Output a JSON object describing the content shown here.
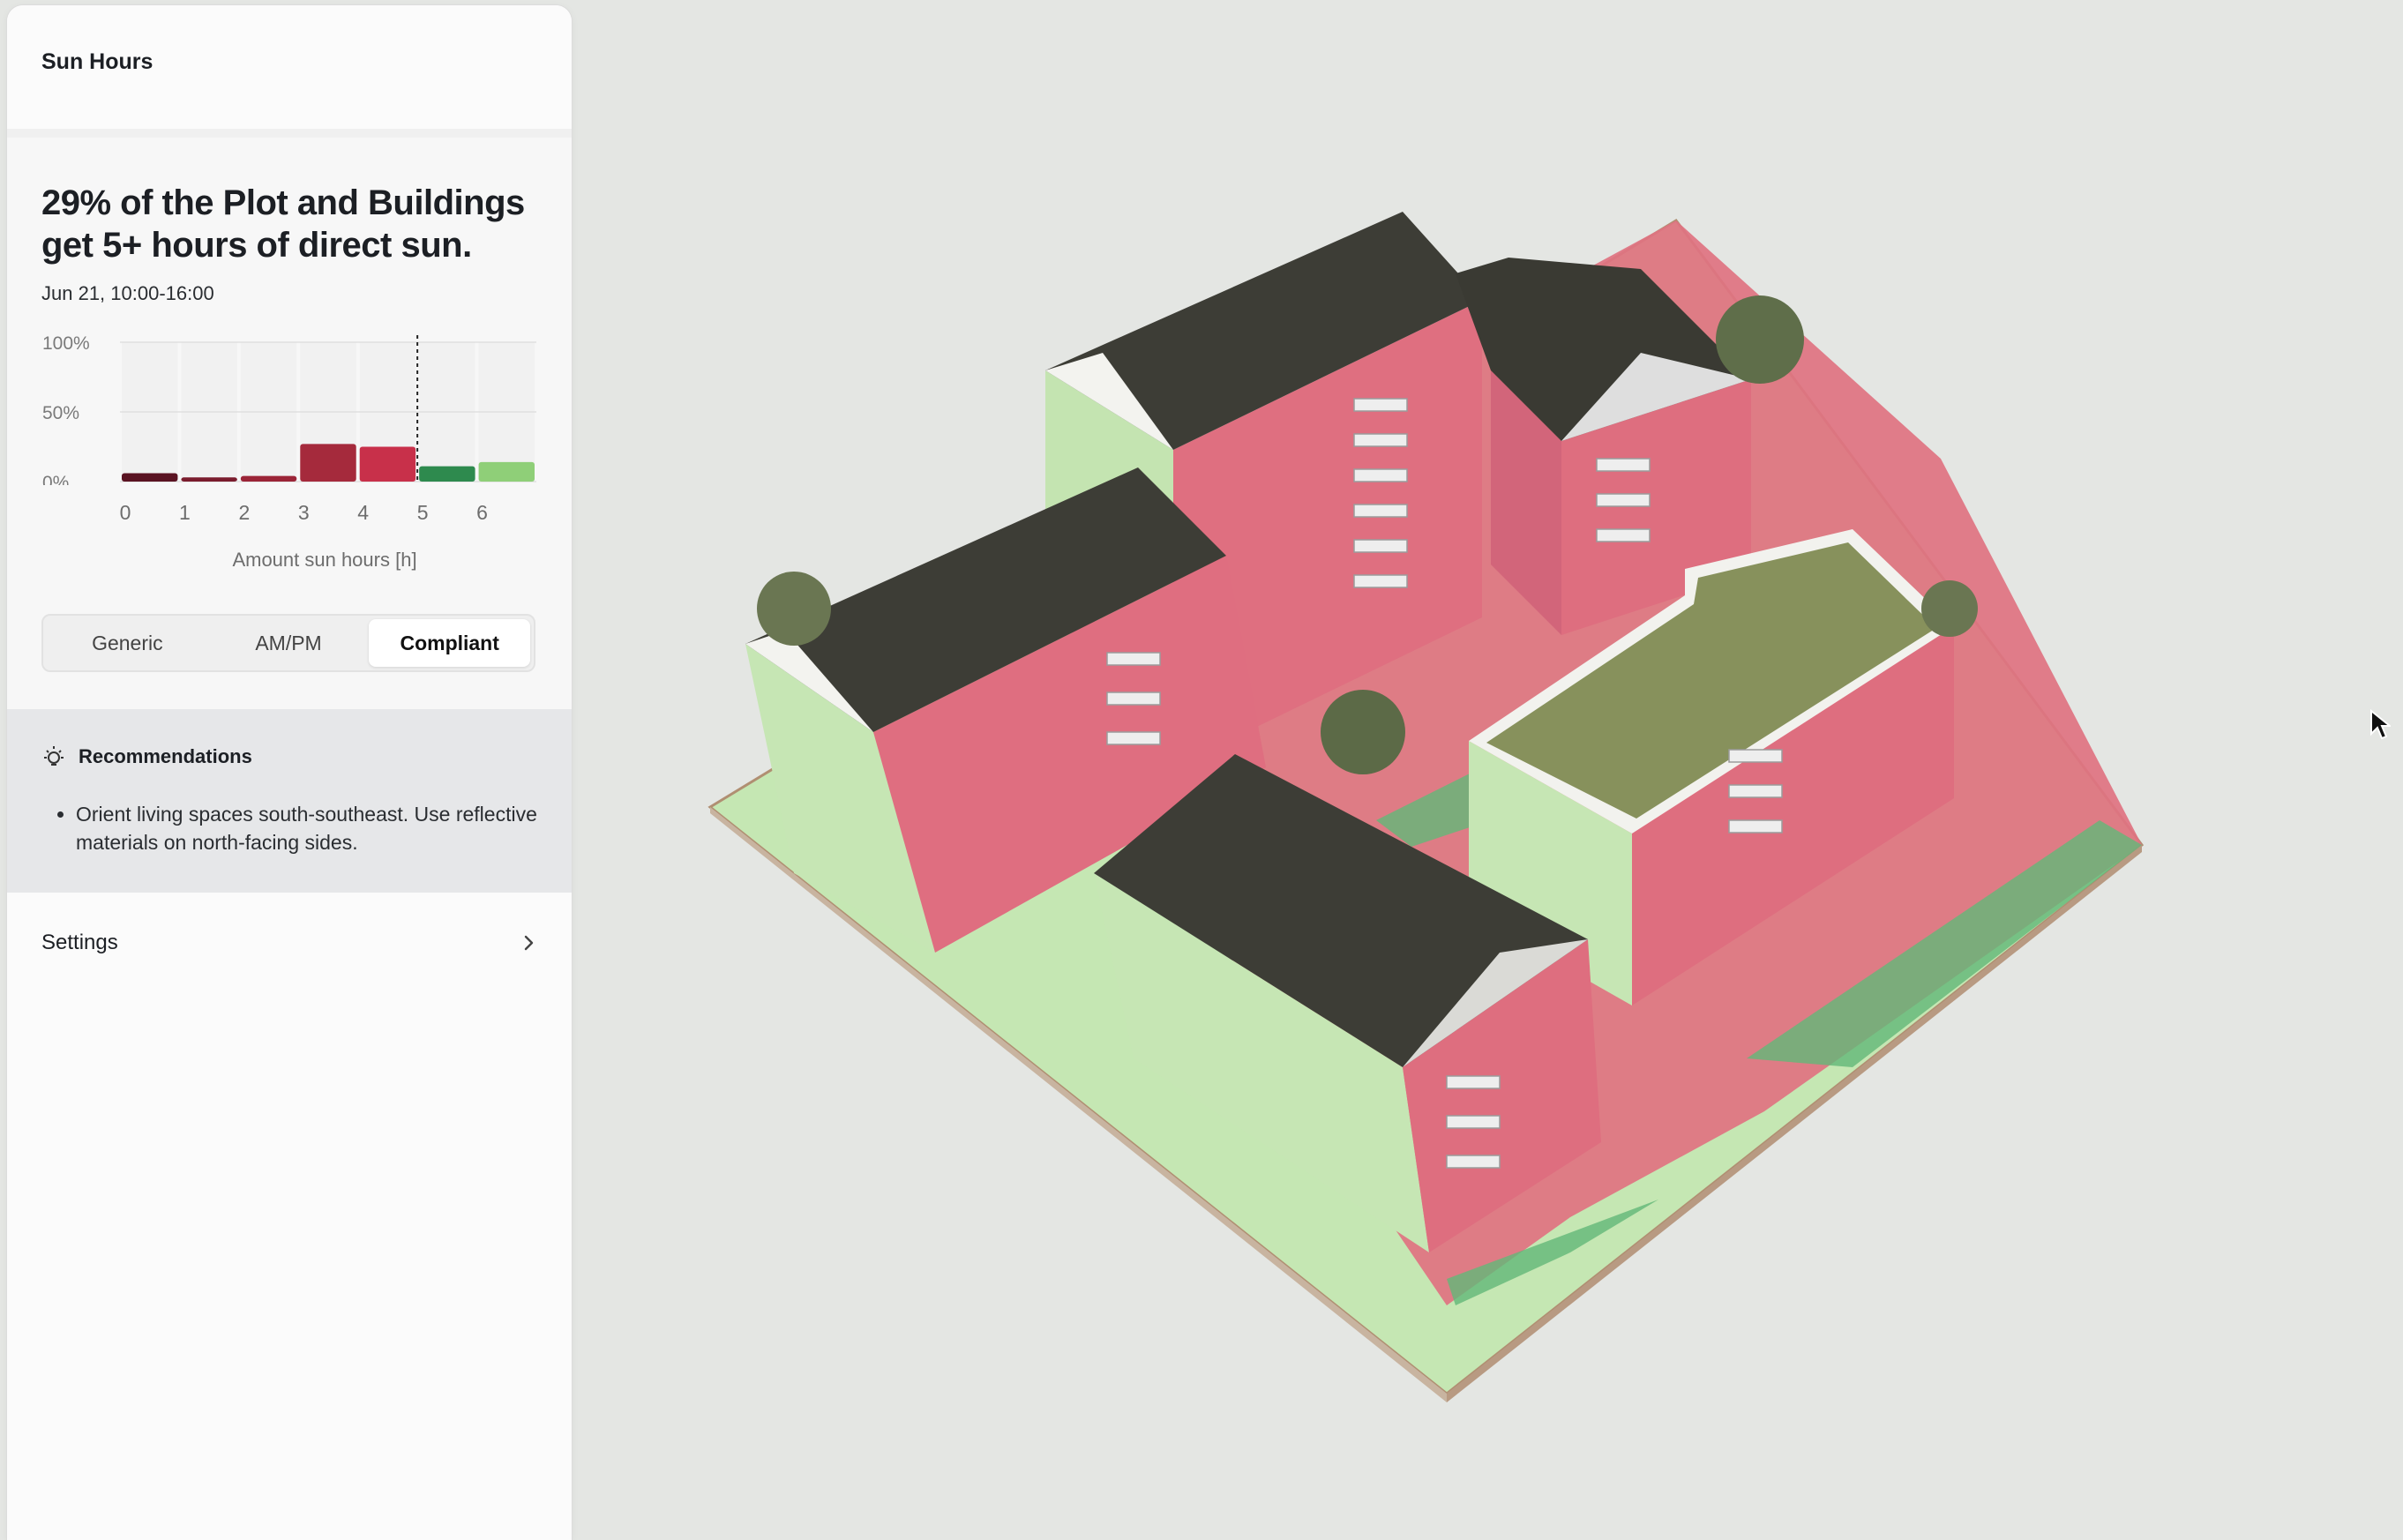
{
  "panel": {
    "title": "Sun Hours",
    "headline": "29% of the Plot and Buildings get 5+ hours of direct sun.",
    "date_range": "Jun 21, 10:00-16:00"
  },
  "chart_data": {
    "type": "bar",
    "categories": [
      "0",
      "1",
      "2",
      "3",
      "4",
      "5",
      "6"
    ],
    "values": [
      6,
      3,
      4,
      27,
      25,
      11,
      14
    ],
    "bar_colors": [
      "#5a1322",
      "#7a1c2d",
      "#9b2437",
      "#a52a3c",
      "#c8304a",
      "#2e8a4e",
      "#8fcf78"
    ],
    "yticks": [
      "100%",
      "50%",
      "0%"
    ],
    "ylim": [
      0,
      100
    ],
    "xlabel": "Amount sun hours [h]",
    "threshold": 5
  },
  "view_modes": {
    "options": [
      "Generic",
      "AM/PM",
      "Compliant"
    ],
    "selected": "Compliant"
  },
  "recommendations": {
    "title": "Recommendations",
    "items": [
      "Orient living spaces south-southeast. Use reflective materials on north-facing sides."
    ]
  },
  "settings": {
    "label": "Settings"
  },
  "colors": {
    "accent_red": "#e0737f",
    "accent_green": "#b9e2a4",
    "roof": "#3d3d36",
    "green_roof": "#87915c"
  },
  "icons": [
    "lightbulb-icon",
    "chevron-right-icon",
    "cursor-icon"
  ]
}
